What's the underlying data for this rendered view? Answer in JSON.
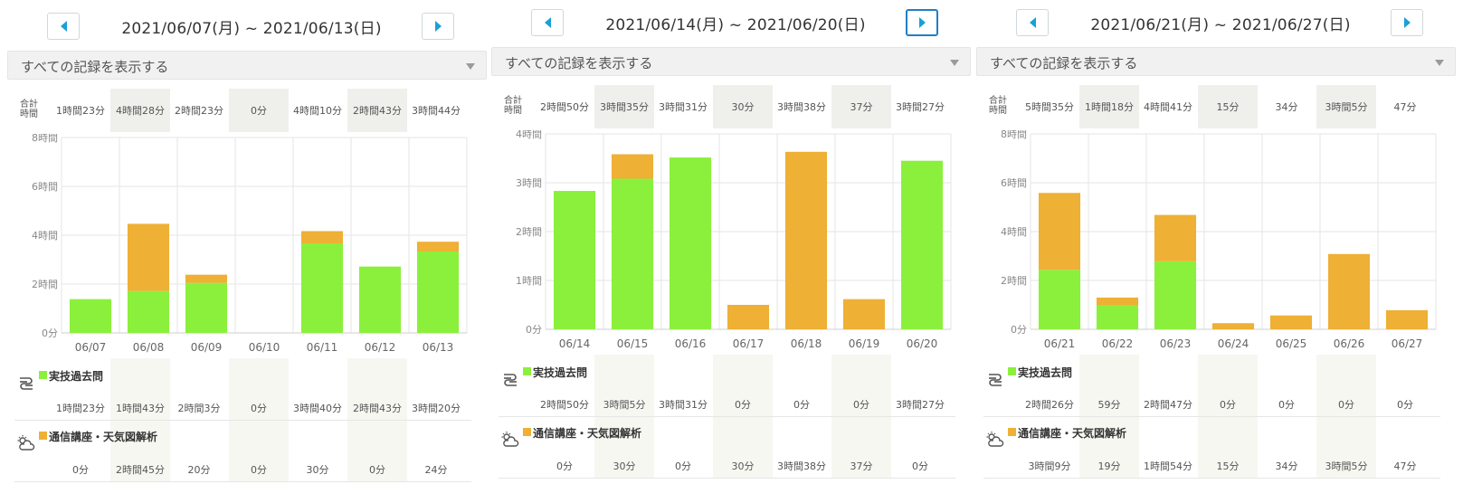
{
  "colors": {
    "green": "#8bf03c",
    "orange": "#eeb035",
    "accent": "#19a0d6",
    "grid": "#e5e5e5",
    "shade": "#efefeb"
  },
  "common": {
    "filter_label": "すべての記録を表示する",
    "totals_label": "合計時間",
    "category1": "実技過去問",
    "category2": "通信講座・天気図解析",
    "category1_icon": "weather-map-icon",
    "category2_icon": "sun-cloud-icon"
  },
  "panels": [
    {
      "range": "2021/06/07(月) ~ 2021/06/13(日)",
      "next_active": false,
      "totals": [
        "1時間23分",
        "4時間28分",
        "2時間23分",
        "0分",
        "4時間10分",
        "2時間43分",
        "3時間44分"
      ],
      "cat1_values": [
        "1時間23分",
        "1時間43分",
        "2時間3分",
        "0分",
        "3時間40分",
        "2時間43分",
        "3時間20分"
      ],
      "cat2_values": [
        "0分",
        "2時間45分",
        "20分",
        "0分",
        "30分",
        "0分",
        "24分"
      ]
    },
    {
      "range": "2021/06/14(月) ~ 2021/06/20(日)",
      "next_active": true,
      "totals": [
        "2時間50分",
        "3時間35分",
        "3時間31分",
        "30分",
        "3時間38分",
        "37分",
        "3時間27分"
      ],
      "cat1_values": [
        "2時間50分",
        "3時間5分",
        "3時間31分",
        "0分",
        "0分",
        "0分",
        "3時間27分"
      ],
      "cat2_values": [
        "0分",
        "30分",
        "0分",
        "30分",
        "3時間38分",
        "37分",
        "0分"
      ]
    },
    {
      "range": "2021/06/21(月) ~ 2021/06/27(日)",
      "next_active": false,
      "totals": [
        "5時間35分",
        "1時間18分",
        "4時間41分",
        "15分",
        "34分",
        "3時間5分",
        "47分"
      ],
      "cat1_values": [
        "2時間26分",
        "59分",
        "2時間47分",
        "0分",
        "0分",
        "0分",
        "0分"
      ],
      "cat2_values": [
        "3時間9分",
        "19分",
        "1時間54分",
        "15分",
        "34分",
        "3時間5分",
        "47分"
      ]
    }
  ],
  "chart_data": [
    {
      "type": "bar",
      "stacked": true,
      "categories": [
        "06/07",
        "06/08",
        "06/09",
        "06/10",
        "06/11",
        "06/12",
        "06/13"
      ],
      "y_ticks": [
        "0分",
        "2時間",
        "4時間",
        "6時間",
        "8時間"
      ],
      "ylim": [
        0,
        8
      ],
      "series": [
        {
          "name": "実技過去問",
          "color": "#8bf03c",
          "values": [
            1.383,
            1.717,
            2.05,
            0,
            3.667,
            2.717,
            3.333
          ]
        },
        {
          "name": "通信講座・天気図解析",
          "color": "#eeb035",
          "values": [
            0,
            2.75,
            0.333,
            0,
            0.5,
            0,
            0.4
          ]
        }
      ]
    },
    {
      "type": "bar",
      "stacked": true,
      "categories": [
        "06/14",
        "06/15",
        "06/16",
        "06/17",
        "06/18",
        "06/19",
        "06/20"
      ],
      "y_ticks": [
        "0分",
        "1時間",
        "2時間",
        "3時間",
        "4時間"
      ],
      "ylim": [
        0,
        4
      ],
      "series": [
        {
          "name": "実技過去問",
          "color": "#8bf03c",
          "values": [
            2.833,
            3.083,
            3.517,
            0,
            0,
            0,
            3.45
          ]
        },
        {
          "name": "通信講座・天気図解析",
          "color": "#eeb035",
          "values": [
            0,
            0.5,
            0,
            0.5,
            3.633,
            0.617,
            0
          ]
        }
      ]
    },
    {
      "type": "bar",
      "stacked": true,
      "categories": [
        "06/21",
        "06/22",
        "06/23",
        "06/24",
        "06/25",
        "06/26",
        "06/27"
      ],
      "y_ticks": [
        "0分",
        "2時間",
        "4時間",
        "6時間",
        "8時間"
      ],
      "ylim": [
        0,
        8
      ],
      "series": [
        {
          "name": "実技過去問",
          "color": "#8bf03c",
          "values": [
            2.433,
            0.983,
            2.783,
            0,
            0,
            0,
            0
          ]
        },
        {
          "name": "通信講座・天気図解析",
          "color": "#eeb035",
          "values": [
            3.15,
            0.317,
            1.9,
            0.25,
            0.567,
            3.083,
            0.783
          ]
        }
      ]
    }
  ]
}
